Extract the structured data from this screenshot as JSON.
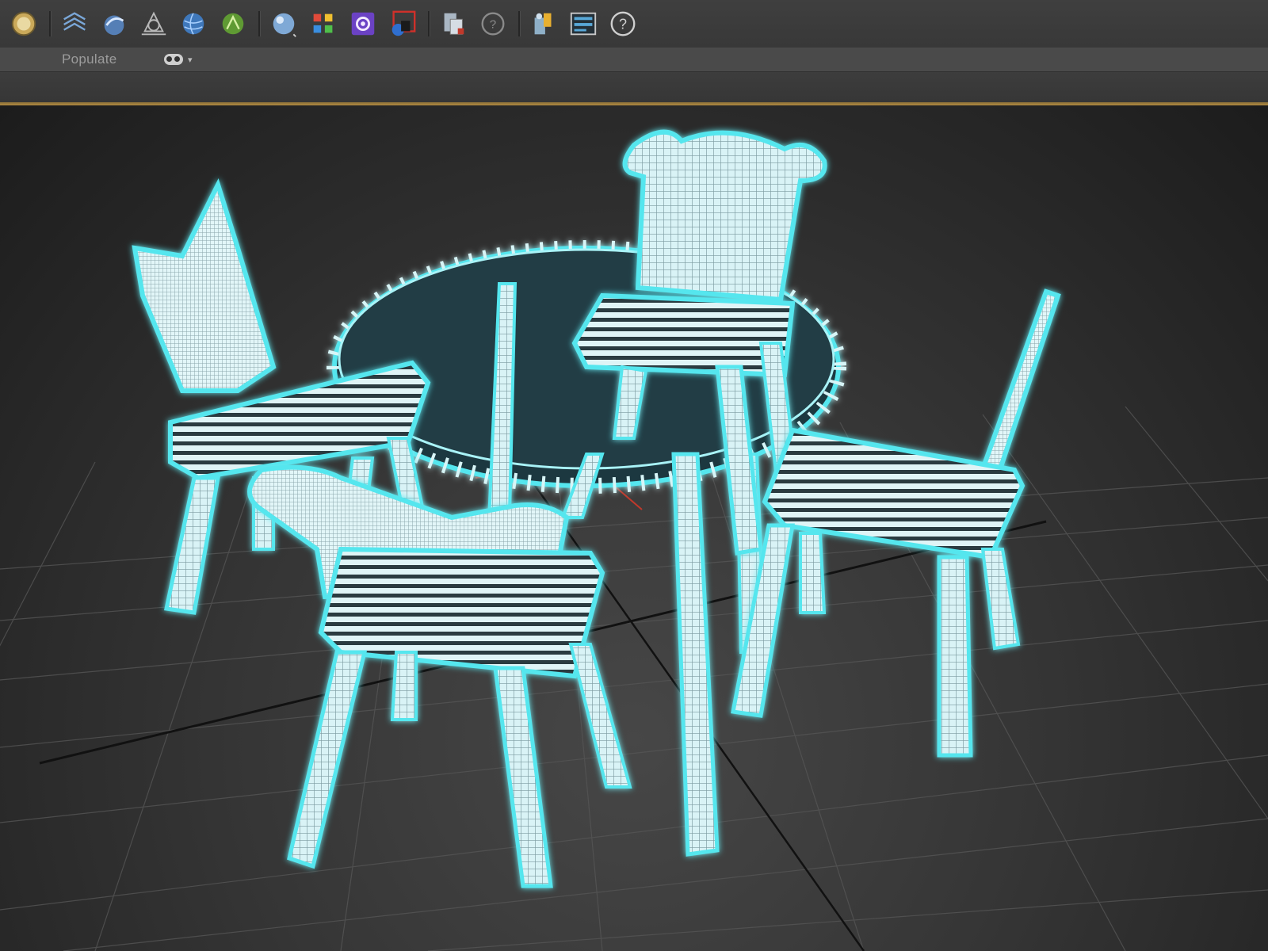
{
  "toolbar": {
    "buttons": [
      {
        "name": "render-setup-icon",
        "color": "#d9c27a"
      },
      {
        "name": "render-frame-icon",
        "color": "#7aa7d8"
      },
      {
        "name": "material-editor-icon",
        "color": "#6b9bd1"
      },
      {
        "name": "scene-explorer-icon",
        "color": "#b8b8b8"
      },
      {
        "name": "environment-icon",
        "color": "#4f86c6"
      },
      {
        "name": "effects-icon",
        "color": "#6aa83c"
      },
      {
        "name": "render-production-icon",
        "color": "#8eb5df"
      },
      {
        "name": "color-grid-icon",
        "color": "#e04a3a"
      },
      {
        "name": "plugin-purple-icon",
        "color": "#7b4dd1"
      },
      {
        "name": "render-region-icon",
        "color": "#d0302a"
      },
      {
        "name": "layer-explorer-icon",
        "color": "#9aa7b4"
      },
      {
        "name": "help-circle-icon",
        "color": "#8a8a8a"
      },
      {
        "name": "user-chat-icon",
        "color": "#e8b030"
      },
      {
        "name": "ribbon-toggle-icon",
        "color": "#58a8d8"
      },
      {
        "name": "help-icon",
        "color": "#cfcfcf"
      }
    ]
  },
  "ribbon": {
    "tab_label": "Populate",
    "toggle_caret": "▾"
  },
  "viewport": {
    "wireframe_color": "#7ff7ff",
    "selection_glow": "#36d9e6",
    "grid_color": "#5a5a5a",
    "accent_gold": "#b08a40"
  }
}
